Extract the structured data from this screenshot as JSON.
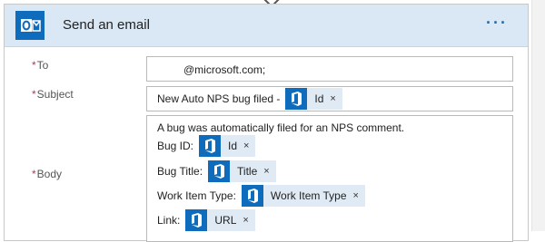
{
  "card": {
    "title": "Send an email",
    "more_label": "···",
    "app_icon": "outlook-icon",
    "header_color": "#d9e8f4",
    "accent": "#0f6cbd"
  },
  "fields": {
    "to": {
      "label": "To",
      "required_mark": "*",
      "value": "@microsoft.com;"
    },
    "subject": {
      "label": "Subject",
      "required_mark": "*",
      "text": "New Auto NPS bug filed -",
      "token": {
        "label": "Id",
        "remove": "×",
        "icon": "devops-icon"
      }
    },
    "body": {
      "label": "Body",
      "required_mark": "*",
      "intro": "A bug was automatically filed for an NPS comment.",
      "lines": [
        {
          "prefix": "Bug ID:",
          "token": "Id",
          "remove": "×"
        },
        {
          "prefix": "Bug Title:",
          "token": "Title",
          "remove": "×"
        },
        {
          "prefix": "Work Item Type:",
          "token": "Work Item Type",
          "remove": "×"
        },
        {
          "prefix": "Link:",
          "token": "URL",
          "remove": "×"
        }
      ]
    }
  }
}
